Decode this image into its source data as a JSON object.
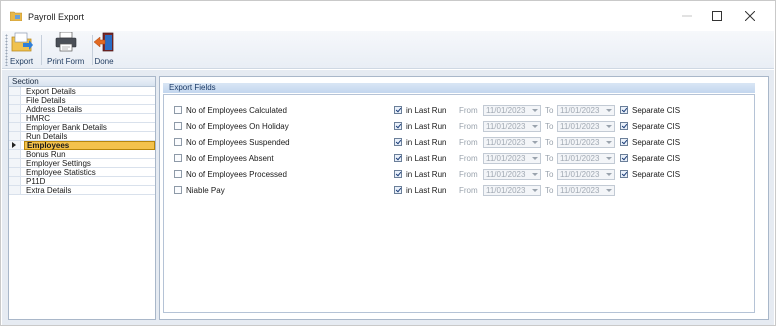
{
  "window": {
    "title": "Payroll Export"
  },
  "toolbar": {
    "export_label": "Export",
    "print_form_label": "Print Form",
    "done_label": "Done"
  },
  "sections": {
    "header": "Section",
    "items": [
      {
        "label": "Export Details"
      },
      {
        "label": "File Details"
      },
      {
        "label": "Address Details"
      },
      {
        "label": "HMRC"
      },
      {
        "label": "Employer Bank Details"
      },
      {
        "label": "Run Details"
      },
      {
        "label": "Employees",
        "selected": true
      },
      {
        "label": "Bonus Run"
      },
      {
        "label": "Employer Settings"
      },
      {
        "label": "Employee Statistics"
      },
      {
        "label": "P11D"
      },
      {
        "label": "Extra Details"
      }
    ]
  },
  "export_fields": {
    "header": "Export Fields",
    "rows": [
      {
        "label": "No of Employees Calculated",
        "checked": false,
        "in_last_run": "in Last Run",
        "in_last_run_checked": true,
        "from": "From",
        "from_date": "11/01/2023",
        "to": "To",
        "to_date": "11/01/2023",
        "separate_cis": "Separate CIS",
        "separate_cis_checked": true
      },
      {
        "label": "No of Employees On Holiday",
        "checked": false,
        "in_last_run": "in Last Run",
        "in_last_run_checked": true,
        "from": "From",
        "from_date": "11/01/2023",
        "to": "To",
        "to_date": "11/01/2023",
        "separate_cis": "Separate CIS",
        "separate_cis_checked": true
      },
      {
        "label": "No of Employees Suspended",
        "checked": false,
        "in_last_run": "in Last Run",
        "in_last_run_checked": true,
        "from": "From",
        "from_date": "11/01/2023",
        "to": "To",
        "to_date": "11/01/2023",
        "separate_cis": "Separate CIS",
        "separate_cis_checked": true
      },
      {
        "label": "No of Employees Absent",
        "checked": false,
        "in_last_run": "in Last Run",
        "in_last_run_checked": true,
        "from": "From",
        "from_date": "11/01/2023",
        "to": "To",
        "to_date": "11/01/2023",
        "separate_cis": "Separate CIS",
        "separate_cis_checked": true
      },
      {
        "label": "No of Employees Processed",
        "checked": false,
        "in_last_run": "in Last Run",
        "in_last_run_checked": true,
        "from": "From",
        "from_date": "11/01/2023",
        "to": "To",
        "to_date": "11/01/2023",
        "separate_cis": "Separate CIS",
        "separate_cis_checked": true
      },
      {
        "label": "Niable Pay",
        "checked": false,
        "in_last_run": "in Last Run",
        "in_last_run_checked": true,
        "from": "From",
        "from_date": "11/01/2023",
        "to": "To",
        "to_date": "11/01/2023"
      }
    ]
  },
  "colors": {
    "selected_row": "#f4c24c",
    "header_blue": "#c3d6ee",
    "accent": "#1b3a66"
  }
}
